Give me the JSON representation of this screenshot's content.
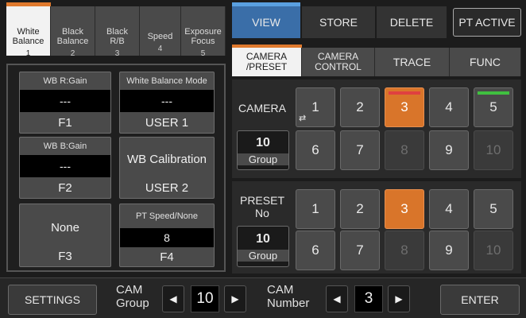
{
  "left_tabs": [
    {
      "label": "White\nBalance",
      "num": "1",
      "active": true
    },
    {
      "label": "Black\nBalance",
      "num": "2",
      "active": false
    },
    {
      "label": "Black\nR/B",
      "num": "3",
      "active": false
    },
    {
      "label": "Speed",
      "num": "4",
      "active": false
    },
    {
      "label": "Exposure\nFocus",
      "num": "5",
      "active": false
    }
  ],
  "cards": {
    "f1": {
      "title": "WB R:Gain",
      "value": "---",
      "foot": "F1"
    },
    "wbmode": {
      "title": "White Balance Mode",
      "value": "---",
      "foot": "USER 1"
    },
    "f2": {
      "title": "WB B:Gain",
      "value": "---",
      "foot": "F2"
    },
    "wbcal": {
      "title": "WB Calibration",
      "foot": "USER 2"
    },
    "f3": {
      "title": "None",
      "foot": "F3"
    },
    "f4": {
      "title": "PT Speed/None",
      "value": "8",
      "foot": "F4"
    }
  },
  "top_tabs": {
    "view": "VIEW",
    "store": "STORE",
    "delete": "DELETE",
    "pt_active": "PT ACTIVE"
  },
  "sub_tabs": {
    "camera_preset": "CAMERA\n/PRESET",
    "camera_control": "CAMERA\nCONTROL",
    "trace": "TRACE",
    "func": "FUNC"
  },
  "camera_section": {
    "label": "CAMERA",
    "group_num": "10",
    "group_label": "Group",
    "buttons": [
      "1",
      "2",
      "3",
      "4",
      "5",
      "6",
      "7",
      "8",
      "9",
      "10"
    ],
    "selected": "3",
    "swap_icon": "swap-arrows-icon"
  },
  "preset_section": {
    "label": "PRESET\nNo",
    "group_num": "10",
    "group_label": "Group",
    "buttons": [
      "1",
      "2",
      "3",
      "4",
      "5",
      "6",
      "7",
      "8",
      "9",
      "10"
    ],
    "selected": "3"
  },
  "bottom": {
    "settings": "SETTINGS",
    "cam_group_label": "CAM\nGroup",
    "cam_group_value": "10",
    "cam_number_label": "CAM\nNumber",
    "cam_number_value": "3",
    "enter": "ENTER",
    "left_arrow": "◀",
    "right_arrow": "▶"
  },
  "colors": {
    "accent_orange": "#d9752a",
    "view_blue": "#3a6ea8",
    "indicator_red": "#e04040",
    "indicator_green": "#40c040"
  }
}
